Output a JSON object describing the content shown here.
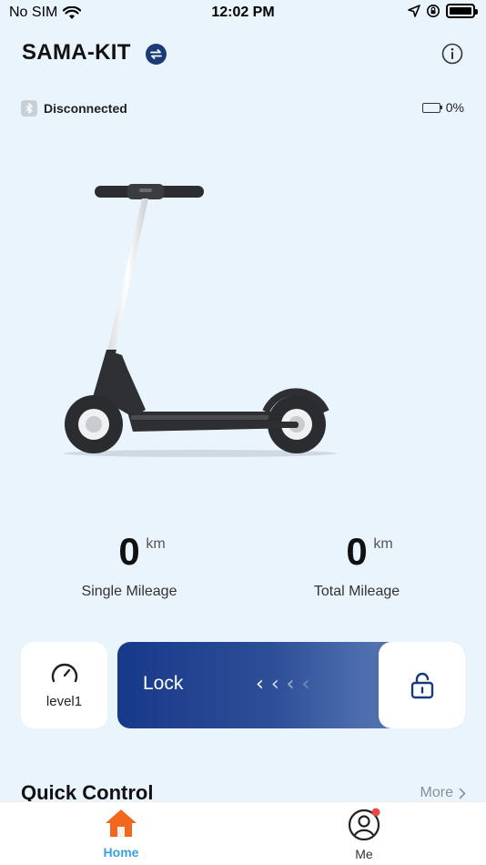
{
  "status_bar": {
    "carrier": "No SIM",
    "time": "12:02 PM"
  },
  "header": {
    "title": "SAMA-KIT",
    "switch_icon": "swap-icon",
    "info_icon": "info-icon"
  },
  "connection": {
    "status": "Disconnected",
    "battery": "0%"
  },
  "mileage": {
    "single": {
      "value": "0",
      "unit": "km",
      "label": "Single Mileage"
    },
    "total": {
      "value": "0",
      "unit": "km",
      "label": "Total Mileage"
    }
  },
  "controls": {
    "level_label": "level1",
    "lock_label": "Lock",
    "chevrons": [
      "‹",
      "‹",
      "‹",
      "‹"
    ]
  },
  "quick_control": {
    "title": "Quick Control",
    "more": "More"
  },
  "tabbar": {
    "home": "Home",
    "me": "Me"
  },
  "colors": {
    "accent": "#1b3a78",
    "home_tab": "#f2661e",
    "home_label": "#3aa0e0",
    "notification_dot": "#e8474a"
  }
}
